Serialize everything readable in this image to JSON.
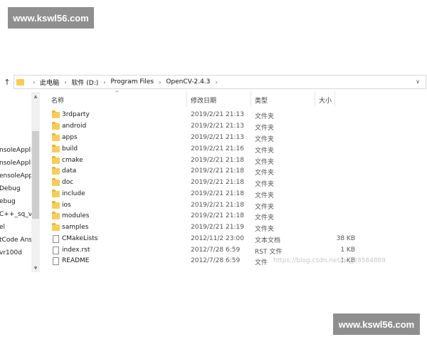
{
  "watermark": "www.kswl56.com",
  "address": {
    "nav_up": "↑",
    "sep": "›",
    "crumbs": [
      "此电脑",
      "软件 (D:)",
      "Program Files",
      "OpenCV-2.4.3"
    ],
    "dropdown": "∨"
  },
  "nav_pane": {
    "items": [
      "nsoleAppli",
      "nsoleAppli",
      "ensoleApp",
      "Debug",
      "ebug",
      "C++_sq_v",
      "el",
      "tCode Ans",
      "vr100d"
    ]
  },
  "scroll": {
    "up": "▲",
    "down": "▼"
  },
  "columns": {
    "sort_indicator": "^",
    "name": "名称",
    "date": "修改日期",
    "type": "类型",
    "size": "大小"
  },
  "files": [
    {
      "name": "3rdparty",
      "date": "2019/2/21 21:13",
      "type": "文件夹",
      "size": "",
      "icon": "folder-icon"
    },
    {
      "name": "android",
      "date": "2019/2/21 21:13",
      "type": "文件夹",
      "size": "",
      "icon": "folder-icon"
    },
    {
      "name": "apps",
      "date": "2019/2/21 21:13",
      "type": "文件夹",
      "size": "",
      "icon": "folder-icon"
    },
    {
      "name": "build",
      "date": "2019/2/21 21:16",
      "type": "文件夹",
      "size": "",
      "icon": "folder-icon"
    },
    {
      "name": "cmake",
      "date": "2019/2/21 21:18",
      "type": "文件夹",
      "size": "",
      "icon": "folder-icon"
    },
    {
      "name": "data",
      "date": "2019/2/21 21:18",
      "type": "文件夹",
      "size": "",
      "icon": "folder-icon"
    },
    {
      "name": "doc",
      "date": "2019/2/21 21:18",
      "type": "文件夹",
      "size": "",
      "icon": "folder-icon"
    },
    {
      "name": "include",
      "date": "2019/2/21 21:18",
      "type": "文件夹",
      "size": "",
      "icon": "folder-icon"
    },
    {
      "name": "ios",
      "date": "2019/2/21 21:18",
      "type": "文件夹",
      "size": "",
      "icon": "folder-icon"
    },
    {
      "name": "modules",
      "date": "2019/2/21 21:18",
      "type": "文件夹",
      "size": "",
      "icon": "folder-icon"
    },
    {
      "name": "samples",
      "date": "2019/2/21 21:19",
      "type": "文件夹",
      "size": "",
      "icon": "folder-icon"
    },
    {
      "name": "CMakeLists",
      "date": "2012/11/2 23:00",
      "type": "文本文档",
      "size": "38 KB",
      "icon": "text-file-icon"
    },
    {
      "name": "index.rst",
      "date": "2012/7/28 6:59",
      "type": "RST 文件",
      "size": "1 KB",
      "icon": "file-icon"
    },
    {
      "name": "README",
      "date": "2012/7/28 6:59",
      "type": "文件",
      "size": "1 KB",
      "icon": "file-icon"
    }
  ],
  "blog_watermark": "https://blog.csdn.net/qq_28584889"
}
